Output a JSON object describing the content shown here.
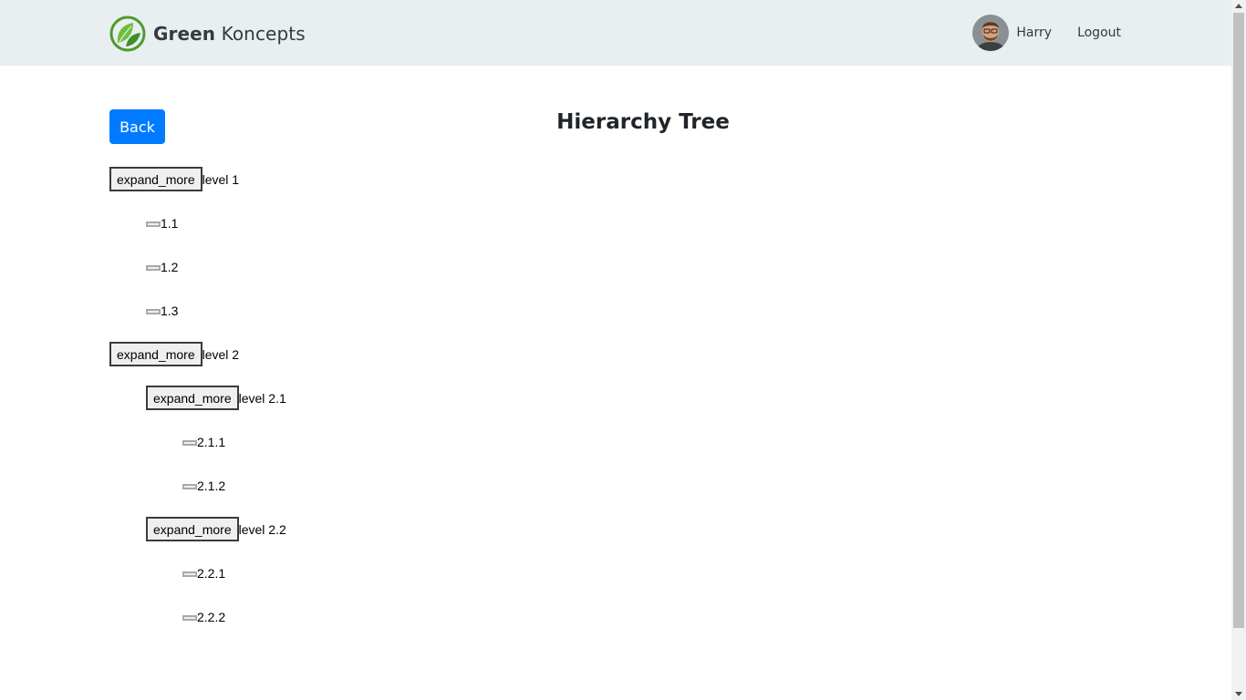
{
  "header": {
    "brand_strong": "Green",
    "brand_light": "Koncepts",
    "username": "Harry",
    "logout_label": "Logout",
    "brand_color": "#5aa63a"
  },
  "main": {
    "back_label": "Back",
    "title": "Hierarchy Tree",
    "accent_color": "#007bff"
  },
  "tree": {
    "expand_label": "expand_more",
    "level1": {
      "label": "level 1",
      "children": [
        "1.1",
        "1.2",
        "1.3"
      ]
    },
    "level2": {
      "label": "level 2",
      "level21": {
        "label": "level 2.1",
        "children": [
          "2.1.1",
          "2.1.2"
        ]
      },
      "level22": {
        "label": "level 2.2",
        "children": [
          "2.2.1",
          "2.2.2"
        ]
      }
    }
  }
}
